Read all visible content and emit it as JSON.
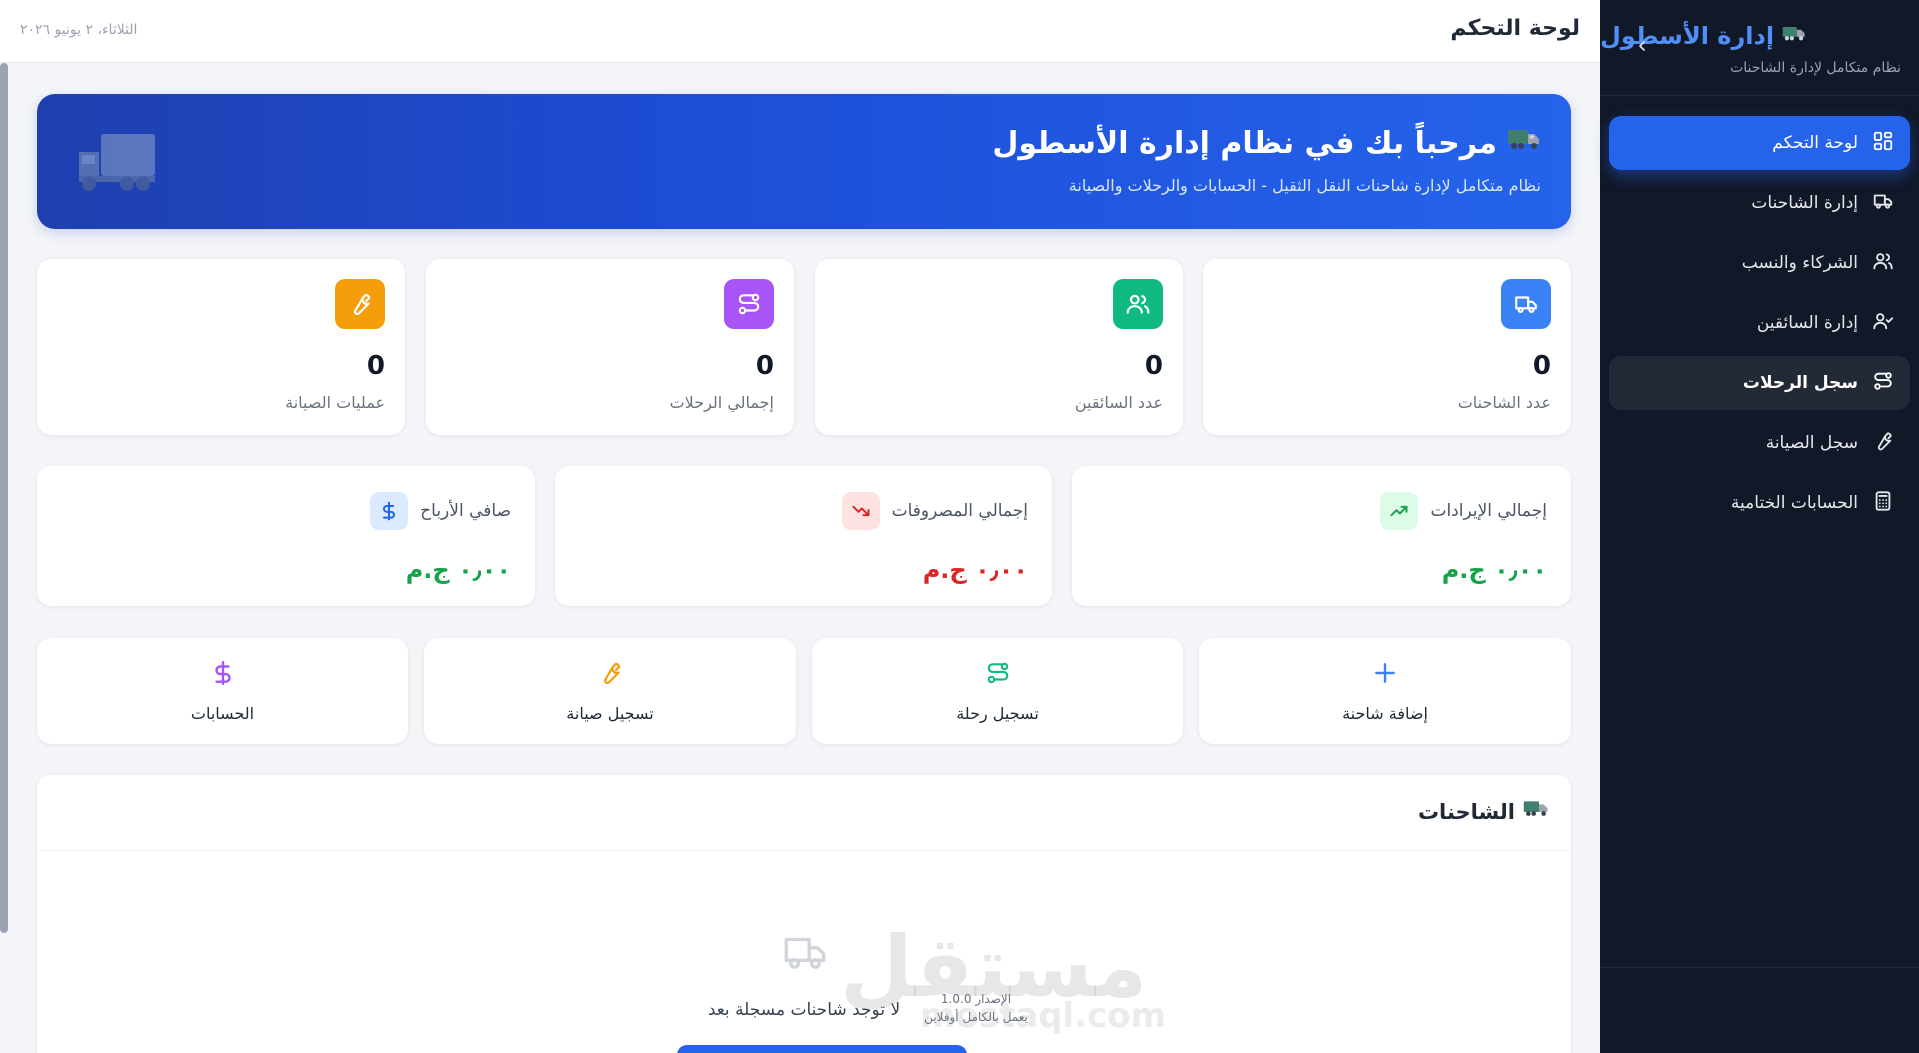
{
  "sidebar": {
    "brand_title": "إدارة الأسطول",
    "brand_sub": "نظام متكامل لإدارة الشاحنات",
    "items": [
      {
        "label": "لوحة التحكم"
      },
      {
        "label": "إدارة الشاحنات"
      },
      {
        "label": "الشركاء والنسب"
      },
      {
        "label": "إدارة السائقين"
      },
      {
        "label": "سجل الرحلات"
      },
      {
        "label": "سجل الصيانة"
      },
      {
        "label": "الحسابات الختامية"
      }
    ]
  },
  "header": {
    "title": "لوحة التحكم",
    "date": "الثلاثاء، ٢ يونيو ٢٠٢٦"
  },
  "banner": {
    "title": "مرحباً بك في نظام إدارة الأسطول",
    "subtitle": "نظام متكامل لإدارة شاحنات النقل الثقيل - الحسابات والرحلات والصيانة"
  },
  "stats": [
    {
      "label": "عدد الشاحنات",
      "value": "0",
      "color": "#3b82f6"
    },
    {
      "label": "عدد السائقين",
      "value": "0",
      "color": "#10b981"
    },
    {
      "label": "إجمالي الرحلات",
      "value": "0",
      "color": "#a855f7"
    },
    {
      "label": "عمليات الصيانة",
      "value": "0",
      "color": "#f59e0b"
    }
  ],
  "finance": [
    {
      "label": "إجمالي الإيرادات",
      "value": "٠٫٠٠ ج.م",
      "color": "#16a34a"
    },
    {
      "label": "إجمالي المصروفات",
      "value": "٠٫٠٠ ج.م",
      "color": "#dc2626"
    },
    {
      "label": "صافي الأرباح",
      "value": "٠٫٠٠ ج.م",
      "color": "#16a34a"
    }
  ],
  "actions": [
    {
      "label": "إضافة شاحنة"
    },
    {
      "label": "تسجيل رحلة"
    },
    {
      "label": "تسجيل صيانة"
    },
    {
      "label": "الحسابات"
    }
  ],
  "trucks_section": {
    "title": "الشاحنات",
    "empty_text": "لا توجد شاحنات مسجلة بعد"
  },
  "footer": {
    "version": "الإصدار 1.0.0",
    "note": "يعمل بالكامل أوفلاين"
  },
  "watermark": {
    "text": "مستقل",
    "sub": "mostaql.com"
  }
}
